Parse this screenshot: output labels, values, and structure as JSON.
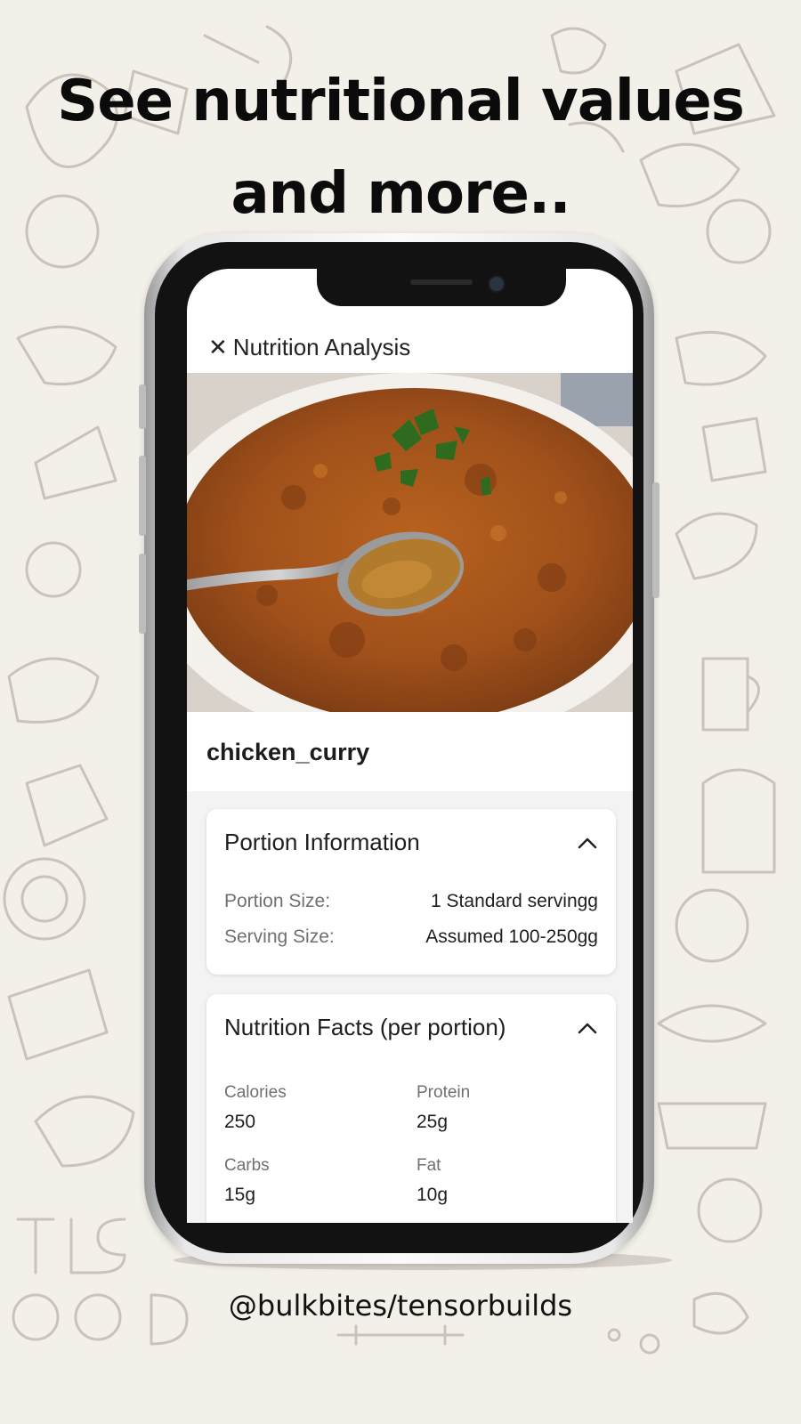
{
  "headline": {
    "line1": "See nutritional values",
    "line2": "and more.."
  },
  "app": {
    "header": {
      "close_icon": "close-icon",
      "close_glyph": "✕",
      "title": "Nutrition Analysis"
    },
    "food": {
      "name": "chicken_curry"
    },
    "portion_card": {
      "title": "Portion Information",
      "rows": [
        {
          "label": "Portion Size:",
          "value": "1 Standard servingg"
        },
        {
          "label": "Serving Size:",
          "value": "Assumed 100-250gg"
        }
      ]
    },
    "nutrition_card": {
      "title": "Nutrition Facts (per portion)",
      "facts": [
        {
          "label": "Calories",
          "value": "250"
        },
        {
          "label": "Protein",
          "value": "25g"
        },
        {
          "label": "Carbs",
          "value": "15g"
        },
        {
          "label": "Fat",
          "value": "10g"
        }
      ]
    }
  },
  "footer": {
    "handle": "@bulkbites/tensorbuilds"
  },
  "colors": {
    "background": "#f3efe9",
    "doodle_stroke": "#c9c3bb",
    "curry": "#a5541a",
    "card_bg": "#ffffff",
    "content_bg": "#f3f3f3"
  }
}
